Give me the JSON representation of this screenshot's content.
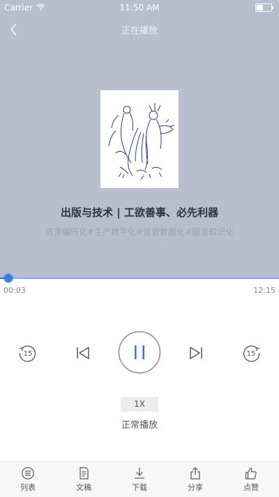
{
  "status_bar": {
    "carrier": "Carrier",
    "time": "11:50 AM"
  },
  "nav": {
    "title": "正在播放"
  },
  "track": {
    "title": "出版与技术 | 工欲善事、必先利器",
    "tags": "资源编码化#生产数字化#运营数据化#服务知识化"
  },
  "progress": {
    "elapsed": "00:03",
    "total": "12:15",
    "fraction": 0.004
  },
  "controls": {
    "rewind_seconds": "15",
    "forward_seconds": "15"
  },
  "speed": {
    "value": "1X",
    "mode_label": "正常播放"
  },
  "tabbar": {
    "items": [
      {
        "label": "列表",
        "icon": "list-icon"
      },
      {
        "label": "文稿",
        "icon": "document-icon"
      },
      {
        "label": "下载",
        "icon": "download-icon"
      },
      {
        "label": "分享",
        "icon": "share-icon"
      },
      {
        "label": "点赞",
        "icon": "thumbs-up-icon"
      }
    ]
  },
  "colors": {
    "hero_bg": "#b9bece",
    "accent": "#3d7be0"
  }
}
